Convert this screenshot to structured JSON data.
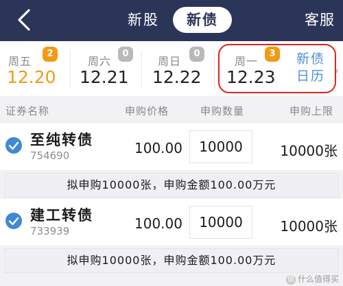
{
  "header": {
    "tabs": [
      {
        "label": "新股"
      },
      {
        "label": "新债"
      }
    ],
    "service_label": "客服"
  },
  "days": [
    {
      "weekday": "周五",
      "date": "12.20",
      "badge": "2"
    },
    {
      "weekday": "周六",
      "date": "12.21",
      "badge": "0"
    },
    {
      "weekday": "周日",
      "date": "12.22",
      "badge": "0"
    },
    {
      "weekday": "周一",
      "date": "12.23",
      "badge": "3"
    }
  ],
  "calendar_link": {
    "line1": "新债",
    "line2": "日历"
  },
  "columns": {
    "name": "证券名称",
    "price": "申购价格",
    "qty": "申购数量",
    "limit": "申购上限"
  },
  "bonds": [
    {
      "name": "至纯转债",
      "code": "754690",
      "price": "100.00",
      "qty": "10000",
      "limit": "10000张",
      "note": "拟申购10000张，申购金额100.00万元"
    },
    {
      "name": "建工转债",
      "code": "733939",
      "price": "100.00",
      "qty": "10000",
      "limit": "10000张",
      "note": "拟申购10000张，申购金额100.00万元"
    }
  ],
  "watermark": "什么值得买",
  "colors": {
    "header_bg": "#2b3557",
    "accent_orange": "#f39a14",
    "link_blue": "#4a90d8",
    "check_blue": "#3f89d6",
    "annotation_red": "#e2231a"
  },
  "icons": {
    "back": "chevron-left-icon",
    "check": "check-circle-icon",
    "more": "chevron-right-icon"
  }
}
